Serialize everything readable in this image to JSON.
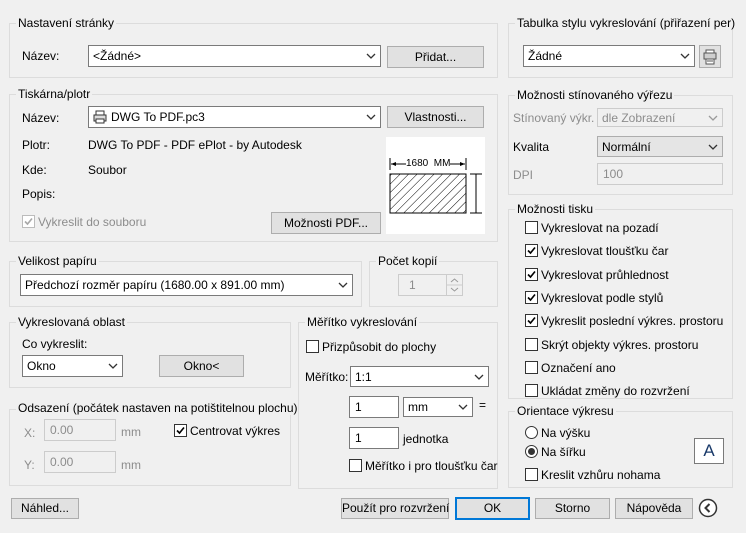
{
  "page_setup": {
    "title": "Nastavení stránky",
    "name_label": "Název:",
    "name_value": "<Žádné>",
    "add_button": "Přidat..."
  },
  "printer": {
    "title": "Tiskárna/plotr",
    "name_label": "Název:",
    "name_value": "DWG To PDF.pc3",
    "properties_button": "Vlastnosti...",
    "plotter_label": "Plotr:",
    "plotter_value": "DWG To PDF - PDF ePlot - by Autodesk",
    "where_label": "Kde:",
    "where_value": "Soubor",
    "description_label": "Popis:",
    "plot_to_file_label": "Vykreslit do souboru",
    "pdf_options_button": "Možnosti PDF...",
    "preview_dimension": "1680  MM"
  },
  "paper_size": {
    "title": "Velikost papíru",
    "value": "Předchozí rozměr papíru  (1680.00 x 891.00 mm)"
  },
  "copies": {
    "title": "Počet kopií",
    "value": "1"
  },
  "plot_area": {
    "title": "Vykreslovaná oblast",
    "what_label": "Co vykreslit:",
    "what_value": "Okno",
    "window_button": "Okno<"
  },
  "plot_scale": {
    "title": "Měřítko vykreslování",
    "fit_label": "Přizpůsobit do plochy",
    "scale_label": "Měřítko:",
    "scale_value": "1:1",
    "value1": "1",
    "unit_value": "mm",
    "equals": "=",
    "value2": "1",
    "unit2_label": "jednotka",
    "scale_lineweights_label": "Měřítko i pro tloušťku čar"
  },
  "plot_offset": {
    "title": "Odsazení (počátek nastaven na potištitelnou plochu)",
    "x_label": "X:",
    "x_value": "0.00",
    "x_unit": "mm",
    "y_label": "Y:",
    "y_value": "0.00",
    "y_unit": "mm",
    "center_label": "Centrovat výkres"
  },
  "style_table": {
    "title": "Tabulka stylu vykreslování (přiřazení per)",
    "value": "Žádné"
  },
  "shaded": {
    "title": "Možnosti stínovaného výřezu",
    "shade_label": "Stínovaný výkr.",
    "shade_value": "dle Zobrazení",
    "quality_label": "Kvalita",
    "quality_value": "Normální",
    "dpi_label": "DPI",
    "dpi_value": "100"
  },
  "plot_options": {
    "title": "Možnosti tisku",
    "items": [
      {
        "label": "Vykreslovat na pozadí",
        "checked": false
      },
      {
        "label": "Vykreslovat tloušťku čar",
        "checked": true
      },
      {
        "label": "Vykreslovat průhlednost",
        "checked": true
      },
      {
        "label": "Vykreslovat podle stylů",
        "checked": true
      },
      {
        "label": "Vykreslit poslední výkres. prostoru",
        "checked": true
      },
      {
        "label": "Skrýt objekty výkres. prostoru",
        "checked": false
      },
      {
        "label": "Označení ano",
        "checked": false
      },
      {
        "label": "Ukládat změny do rozvržení",
        "checked": false
      }
    ]
  },
  "orientation": {
    "title": "Orientace výkresu",
    "portrait_label": "Na výšku",
    "landscape_label": "Na šířku",
    "upside_down_label": "Kreslit vzhůru nohama",
    "selected": "landscape",
    "icon_letter": "A"
  },
  "footer": {
    "preview_button": "Náhled...",
    "apply_button": "Použít pro rozvržení",
    "ok_button": "OK",
    "cancel_button": "Storno",
    "help_button": "Nápověda"
  }
}
